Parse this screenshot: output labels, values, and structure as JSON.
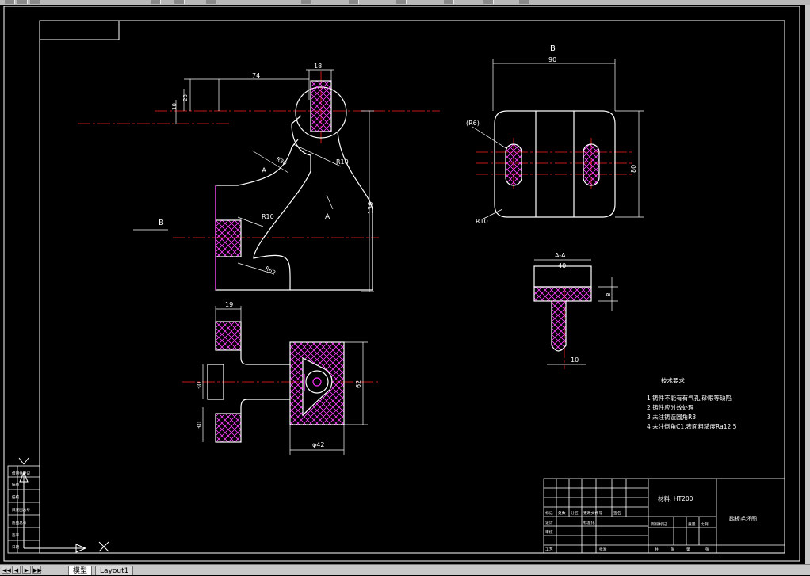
{
  "layout_tabs": [
    {
      "label": "模型",
      "active": true
    },
    {
      "label": "Layout1",
      "active": false
    }
  ],
  "nav_buttons": [
    "◀◀",
    "◀",
    "▶",
    "▶▶"
  ],
  "drawing": {
    "view_b_label": "B",
    "view_b_arrow_label": "B",
    "section_label": "A-A",
    "section_mark": "A",
    "dims_front": {
      "d74": "74",
      "d18": "18",
      "d23": "23",
      "d10": "10",
      "d136": "136",
      "r10a": "R10",
      "r10b": "R10",
      "r30": "R30",
      "r62": "R62"
    },
    "dims_view_b": {
      "d90": "90",
      "d80": "80",
      "r6": "(R6)",
      "r10": "R10"
    },
    "dims_section": {
      "d40": "40",
      "d8": "8",
      "d10": "10"
    },
    "dims_bottom": {
      "d19": "19",
      "d30a": "30",
      "d30b": "30",
      "d62": "62",
      "phi42": "φ42"
    }
  },
  "tech_requirements": {
    "title": "技术要求",
    "items": [
      "1   铸件不能有有气孔,砂眼等缺陷",
      "2   铸件应时效处理",
      "3   未注铸造圆角R3",
      "4   未注倒角C1,表面粗糙度Ra12.5"
    ]
  },
  "title_block": {
    "material": "材料: HT200",
    "part_name": "踏板毛坯图",
    "cells": [
      "标记",
      "处数",
      "分区",
      "更改文件号",
      "签名",
      "设计",
      "标准化",
      "阶段标记",
      "重量",
      "比例",
      "审核",
      "工艺",
      "批准",
      "共",
      "张",
      "第",
      "张"
    ]
  },
  "side_block": {
    "cells": [
      "借用件登记",
      "描图",
      "描校",
      "旧底图总号",
      "底图总号",
      "签字",
      "日期"
    ]
  },
  "colors": {
    "white": "#ffffff",
    "red": "#ff2020",
    "magenta": "#ff30ff",
    "green": "#20ff20",
    "yellow": "#ffff00"
  }
}
